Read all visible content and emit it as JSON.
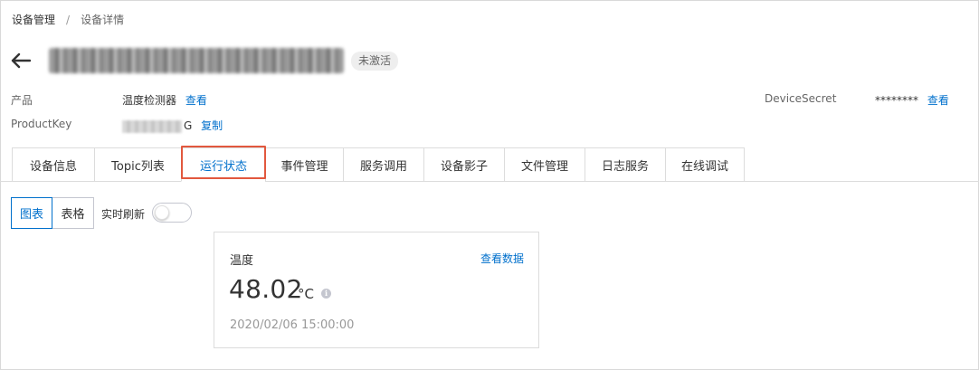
{
  "breadcrumb": {
    "items": [
      "设备管理",
      "设备详情"
    ],
    "separator": "/"
  },
  "header": {
    "back_icon": "arrow-left-icon",
    "status": "未激活"
  },
  "meta": {
    "product_label": "产品",
    "product_value": "温度检测器",
    "product_link": "查看",
    "productkey_label": "ProductKey",
    "productkey_suffix": "G",
    "productkey_link": "复制",
    "secret_label": "DeviceSecret",
    "secret_value": "********",
    "secret_link": "查看"
  },
  "tabs": [
    {
      "label": "设备信息"
    },
    {
      "label": "Topic列表"
    },
    {
      "label": "运行状态",
      "active": true
    },
    {
      "label": "事件管理"
    },
    {
      "label": "服务调用"
    },
    {
      "label": "设备影子"
    },
    {
      "label": "文件管理"
    },
    {
      "label": "日志服务"
    },
    {
      "label": "在线调试"
    }
  ],
  "view": {
    "chart_label": "图表",
    "table_label": "表格",
    "refresh_label": "实时刷新",
    "refresh_on": false
  },
  "card": {
    "title": "温度",
    "link": "查看数据",
    "value": "48.02",
    "unit": "°C",
    "info_icon": "info-icon",
    "timestamp": "2020/02/06 15:00:00"
  },
  "colors": {
    "accent": "#0070cc",
    "highlight": "#e2583e"
  }
}
